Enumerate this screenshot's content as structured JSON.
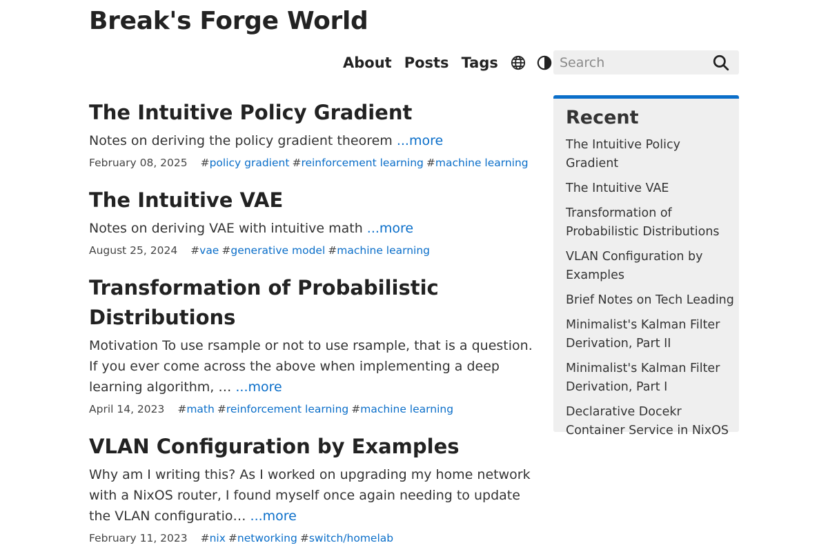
{
  "site": {
    "title": "Break's Forge World"
  },
  "nav": {
    "links": [
      "About",
      "Posts",
      "Tags"
    ],
    "search_placeholder": "Search",
    "language_icon": "globe-icon",
    "theme_icon": "contrast-icon",
    "search_icon": "magnifier-icon"
  },
  "colors": {
    "accent": "#0a6ec9",
    "sidebar_bg": "#efefef",
    "text": "#222222"
  },
  "posts": [
    {
      "title": "The Intuitive Policy Gradient",
      "summary": "Notes on deriving the policy gradient theorem ",
      "more": "...more",
      "date": "February 08, 2025",
      "tags": [
        "policy gradient",
        "reinforcement learning",
        "machine learning"
      ]
    },
    {
      "title": "The Intuitive VAE",
      "summary": "Notes on deriving VAE with intuitive math ",
      "more": "...more",
      "date": "August 25, 2024",
      "tags": [
        "vae",
        "generative model",
        "machine learning"
      ]
    },
    {
      "title": "Transformation of Probabilistic Distributions",
      "summary": "Motivation To use rsample or not to use rsample, that is a question. If you ever come across the above when implementing a deep learning algorithm, … ",
      "more": "...more",
      "date": "April 14, 2023",
      "tags": [
        "math",
        "reinforcement learning",
        "machine learning"
      ]
    },
    {
      "title": "VLAN Configuration by Examples",
      "summary": "Why am I writing this? As I worked on upgrading my home network with a NixOS router, I found myself once again needing to update the VLAN configuratio… ",
      "more": "...more",
      "date": "February 11, 2023",
      "tags": [
        "nix",
        "networking",
        "switch/homelab"
      ]
    }
  ],
  "sidebar": {
    "title": "Recent",
    "items": [
      "The Intuitive Policy Gradient",
      "The Intuitive VAE",
      "Transformation of Probabilistic Distributions",
      "VLAN Configuration by Examples",
      "Brief Notes on Tech Leading",
      "Minimalist's Kalman Filter Derivation, Part II",
      "Minimalist's Kalman Filter Derivation, Part I",
      "Declarative Docekr Container Service in NixOS"
    ]
  }
}
